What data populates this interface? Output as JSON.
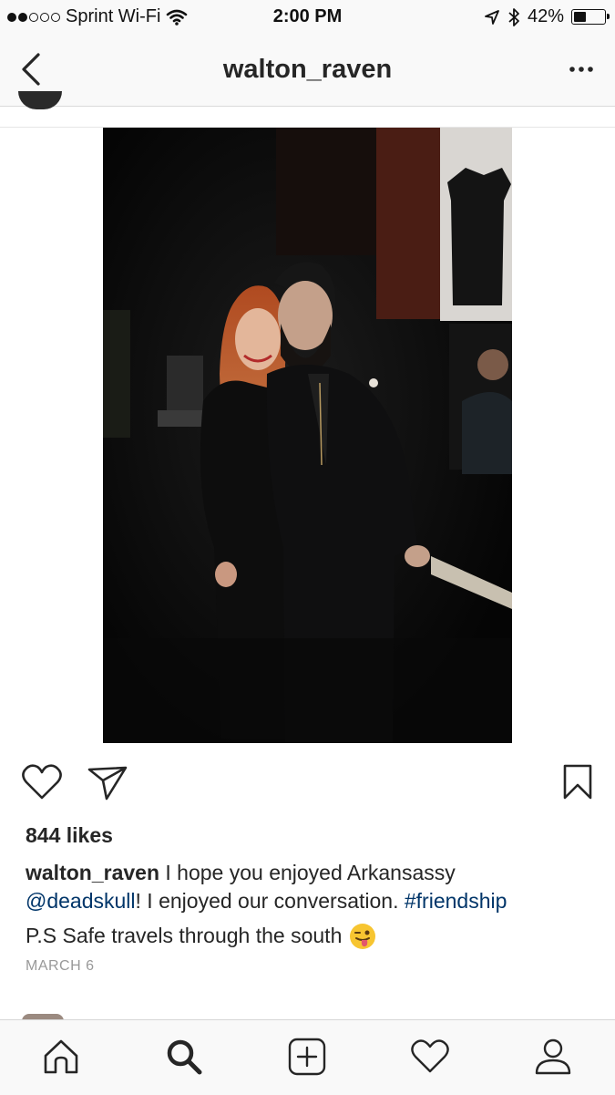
{
  "status_bar": {
    "carrier": "Sprint Wi-Fi",
    "time": "2:00 PM",
    "battery_percent": "42%",
    "battery_level": 0.42,
    "signal_bars": 2
  },
  "nav": {
    "title": "walton_raven",
    "back_icon": "chevron-left-icon",
    "more_icon": "ellipsis-icon"
  },
  "post": {
    "likes": "844 likes",
    "caption": {
      "username": "walton_raven",
      "text_1": " I hope you enjoyed Arkansassy",
      "mention": "@deadskull",
      "text_2": "! I enjoyed our conversation. ",
      "hashtag": "#friendship",
      "line_3": "P.S Safe travels through the south",
      "emoji": "winking-face-with-tongue"
    },
    "date": "MARCH 6"
  },
  "tabs": [
    {
      "name": "home",
      "icon": "home-icon"
    },
    {
      "name": "search",
      "icon": "search-icon"
    },
    {
      "name": "new-post",
      "icon": "add-post-icon"
    },
    {
      "name": "activity",
      "icon": "heart-icon"
    },
    {
      "name": "profile",
      "icon": "profile-icon"
    }
  ],
  "colors": {
    "link": "#003569",
    "text": "#262626",
    "muted": "#999999",
    "bar_background": "#f9f9f9"
  }
}
